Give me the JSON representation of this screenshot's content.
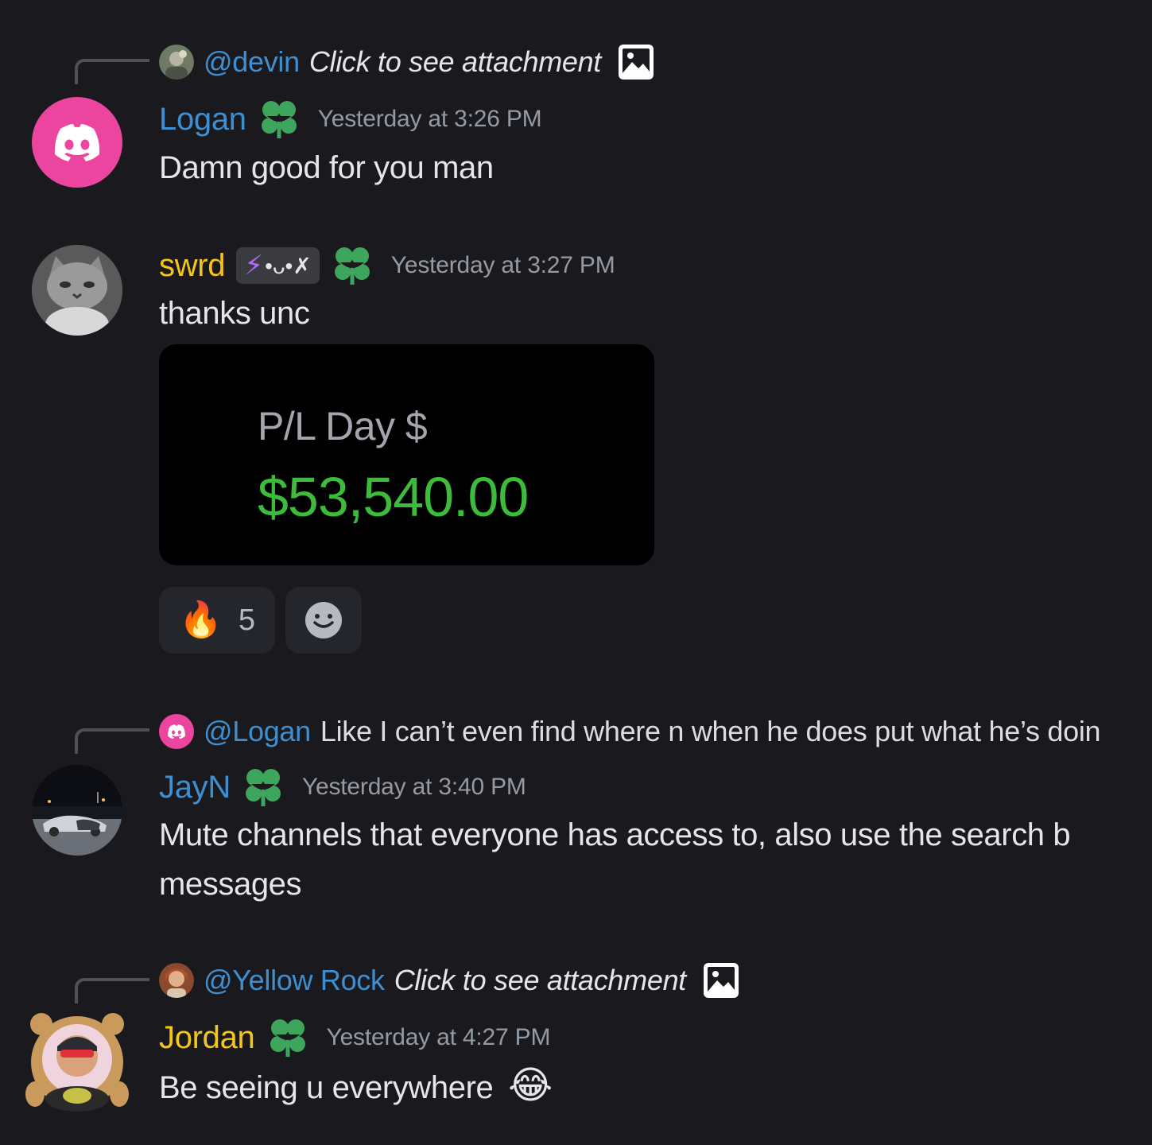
{
  "messages": [
    {
      "reply": {
        "mention": "@devin",
        "text": "Click to see attachment",
        "has_attachment_icon": true
      },
      "author": "Logan",
      "author_color": "#3f8fd0",
      "timestamp": "Yesterday at 3:26 PM",
      "content": "Damn good for you man"
    },
    {
      "author": "swrd",
      "author_color": "#f5c518",
      "tag": {
        "icon": "⚡",
        "text": "•ᴗ•✗"
      },
      "timestamp": "Yesterday at 3:27 PM",
      "content": "thanks unc",
      "embed": {
        "label": "P/L Day $",
        "value": "$53,540.00"
      },
      "reactions": [
        {
          "emoji": "🔥",
          "count": "5"
        }
      ]
    },
    {
      "reply": {
        "mention": "@Logan",
        "text": "Like I can’t even find where n when he does put what he’s doin"
      },
      "author": "JayN",
      "author_color": "#3f8fd0",
      "timestamp": "Yesterday at 3:40 PM",
      "content_lines": [
        "Mute channels that everyone has access to, also use the search b",
        "messages"
      ]
    },
    {
      "reply": {
        "mention": "@Yellow Rock",
        "text": "Click to see attachment",
        "has_attachment_icon": true
      },
      "author": "Jordan",
      "author_color": "#f5c518",
      "timestamp": "Yesterday at 4:27 PM",
      "content": "Be seeing u everywhere",
      "content_emoji": "😂"
    }
  ],
  "colors": {
    "background": "#1a1a1e",
    "mention": "#3f8fd0",
    "timestamp": "#949ba4",
    "role_icon": "#3ea55c",
    "pl_value": "#3dbb3a",
    "discord_pink": "#eb459f"
  },
  "icons": {
    "role": "green-clover-role-icon",
    "attachment": "image-attachment-icon",
    "add_reaction": "add-reaction-smiley-icon",
    "discord_avatar": "discord-logo-icon"
  }
}
